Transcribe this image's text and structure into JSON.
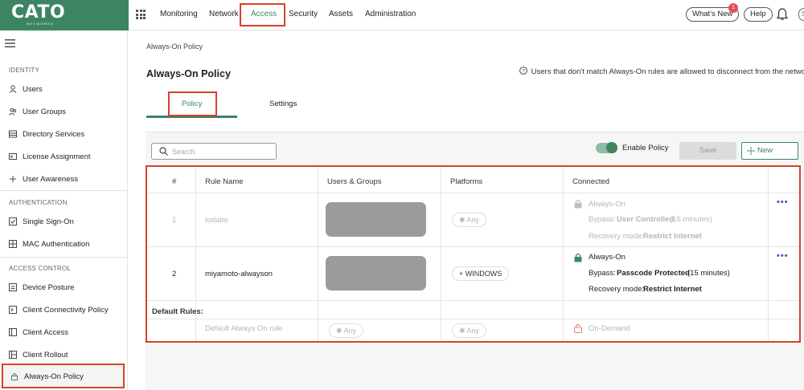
{
  "brand": {
    "name": "CATO",
    "sub": "NETWORKS",
    "color": "#3d8463"
  },
  "header": {
    "nav": [
      "Monitoring",
      "Network",
      "Access",
      "Security",
      "Assets",
      "Administration"
    ],
    "active_nav": "Access",
    "whats_new": "What's New",
    "whats_new_badge": "1",
    "help": "Help",
    "avatar_initial": "S"
  },
  "sidebar": {
    "sections": [
      {
        "title": "IDENTITY",
        "items": [
          {
            "label": "Users",
            "icon": "user-icon"
          },
          {
            "label": "User Groups",
            "icon": "user-groups-icon"
          },
          {
            "label": "Directory Services",
            "icon": "directory-icon"
          },
          {
            "label": "License Assignment",
            "icon": "license-icon"
          },
          {
            "label": "User Awareness",
            "icon": "plus-icon"
          }
        ]
      },
      {
        "title": "AUTHENTICATION",
        "items": [
          {
            "label": "Single Sign-On",
            "icon": "checkbox-icon"
          },
          {
            "label": "MAC Authentication",
            "icon": "grid-icon"
          }
        ]
      },
      {
        "title": "ACCESS CONTROL",
        "items": [
          {
            "label": "Device Posture",
            "icon": "device-icon"
          },
          {
            "label": "Client Connectivity Policy",
            "icon": "connectivity-icon"
          },
          {
            "label": "Client Access",
            "icon": "client-access-icon"
          },
          {
            "label": "Client Rollout",
            "icon": "rollout-icon"
          },
          {
            "label": "Always-On Policy",
            "icon": "lock-icon"
          }
        ]
      }
    ],
    "active_item": "Always-On Policy"
  },
  "page": {
    "breadcrumb": "Always-On Policy",
    "title": "Always-On Policy",
    "info_note": "Users that don't match Always-On rules are allowed to disconnect from the network",
    "tabs": [
      "Policy",
      "Settings"
    ],
    "active_tab": "Policy"
  },
  "toolbar": {
    "search_placeholder": "Search",
    "enable_policy_label": "Enable Policy",
    "enable_policy_on": true,
    "save_label": "Save",
    "new_label": "New"
  },
  "table": {
    "columns": [
      "#",
      "Rule Name",
      "Users & Groups",
      "Platforms",
      "Connected"
    ],
    "rows": [
      {
        "num": "1",
        "name": "todaito",
        "platform": "Any",
        "enabled": false,
        "status": "Always-On",
        "bypass_label": "Bypass:",
        "bypass_value": "User Controlled",
        "bypass_suffix": "(15 minutes)",
        "recovery_label": "Recovery mode:",
        "recovery_value": "Restrict Internet"
      },
      {
        "num": "2",
        "name": "miyamoto-alwayson",
        "platform": "WINDOWS",
        "enabled": true,
        "status": "Always-On",
        "bypass_label": "Bypass:",
        "bypass_value": "Passcode Protected",
        "bypass_suffix": "(15 minutes)",
        "recovery_label": "Recovery mode:",
        "recovery_value": "Restrict Internet"
      }
    ],
    "default_rules_label": "Default Rules:",
    "default_rule": {
      "name": "Default Always On rule",
      "users": "Any",
      "platform": "Any",
      "status": "On-Demand"
    }
  },
  "colors": {
    "accent": "#3d8463",
    "highlight": "#d9402b",
    "link_blue": "#3a5fb8",
    "muted": "#b5b5b5"
  }
}
